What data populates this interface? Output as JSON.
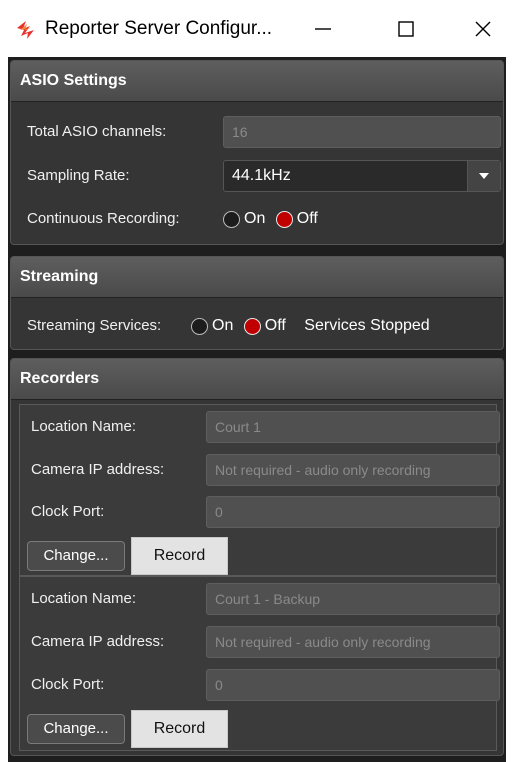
{
  "window": {
    "title": "Reporter Server Configur...",
    "minimize_glyph": "—",
    "maximize_glyph": "☐",
    "close_glyph": "✕"
  },
  "asio": {
    "header": "ASIO Settings",
    "channels_label": "Total ASIO channels:",
    "channels_value": "16",
    "sampling_label": "Sampling Rate:",
    "sampling_value": "44.1kHz",
    "recording_label": "Continuous Recording:",
    "recording_on": "On",
    "recording_off": "Off",
    "recording_selected": "Off"
  },
  "streaming": {
    "header": "Streaming",
    "services_label": "Streaming Services:",
    "services_on": "On",
    "services_off": "Off",
    "services_selected": "Off",
    "status": "Services Stopped"
  },
  "recorders": {
    "header": "Recorders",
    "items": [
      {
        "location_label": "Location Name:",
        "location_value": "Court 1",
        "camera_label": "Camera IP address:",
        "camera_value": "Not required - audio only recording",
        "clock_label": "Clock Port:",
        "clock_value": "0",
        "change_label": "Change...",
        "record_label": "Record"
      },
      {
        "location_label": "Location Name:",
        "location_value": "Court 1 - Backup",
        "camera_label": "Camera IP address:",
        "camera_value": "Not required - audio only recording",
        "clock_label": "Clock Port:",
        "clock_value": "0",
        "change_label": "Change...",
        "record_label": "Record"
      }
    ]
  },
  "colors": {
    "radio_selected": "#c00000",
    "panel_bg": "#353535",
    "header_bg": "#555555",
    "input_bg": "#505050"
  }
}
